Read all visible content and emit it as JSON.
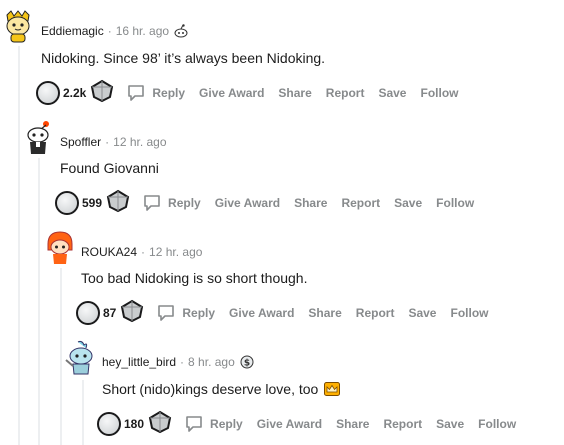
{
  "comments": [
    {
      "author": "Eddiemagic",
      "time": "16 hr. ago",
      "flair_icon": "snoo-flair-icon",
      "body": "Nidoking. Since 98’ it’s always been Nidoking.",
      "score": "2.2k",
      "actions": {
        "reply": "Reply",
        "give_award": "Give Award",
        "share": "Share",
        "report": "Report",
        "save": "Save",
        "follow": "Follow"
      }
    },
    {
      "author": "Spoffler",
      "time": "12 hr. ago",
      "body": "Found Giovanni",
      "score": "599",
      "actions": {
        "reply": "Reply",
        "give_award": "Give Award",
        "share": "Share",
        "report": "Report",
        "save": "Save",
        "follow": "Follow"
      }
    },
    {
      "author": "ROUKA24",
      "time": "12 hr. ago",
      "body": "Too bad Nidoking is so short though.",
      "score": "87",
      "actions": {
        "reply": "Reply",
        "give_award": "Give Award",
        "share": "Share",
        "report": "Report",
        "save": "Save",
        "follow": "Follow"
      }
    },
    {
      "author": "hey_little_bird",
      "time": "8 hr. ago",
      "flair_icon": "money-flair-icon",
      "body": "Short (nido)kings deserve love, too",
      "body_emoji": "crown-icon",
      "score": "180",
      "actions": {
        "reply": "Reply",
        "give_award": "Give Award",
        "share": "Share",
        "report": "Report",
        "save": "Save",
        "follow": "Follow"
      }
    }
  ],
  "colors": {
    "meta": "#878a8c",
    "text": "#1c1c1c",
    "thread_line": "#edeff1"
  }
}
